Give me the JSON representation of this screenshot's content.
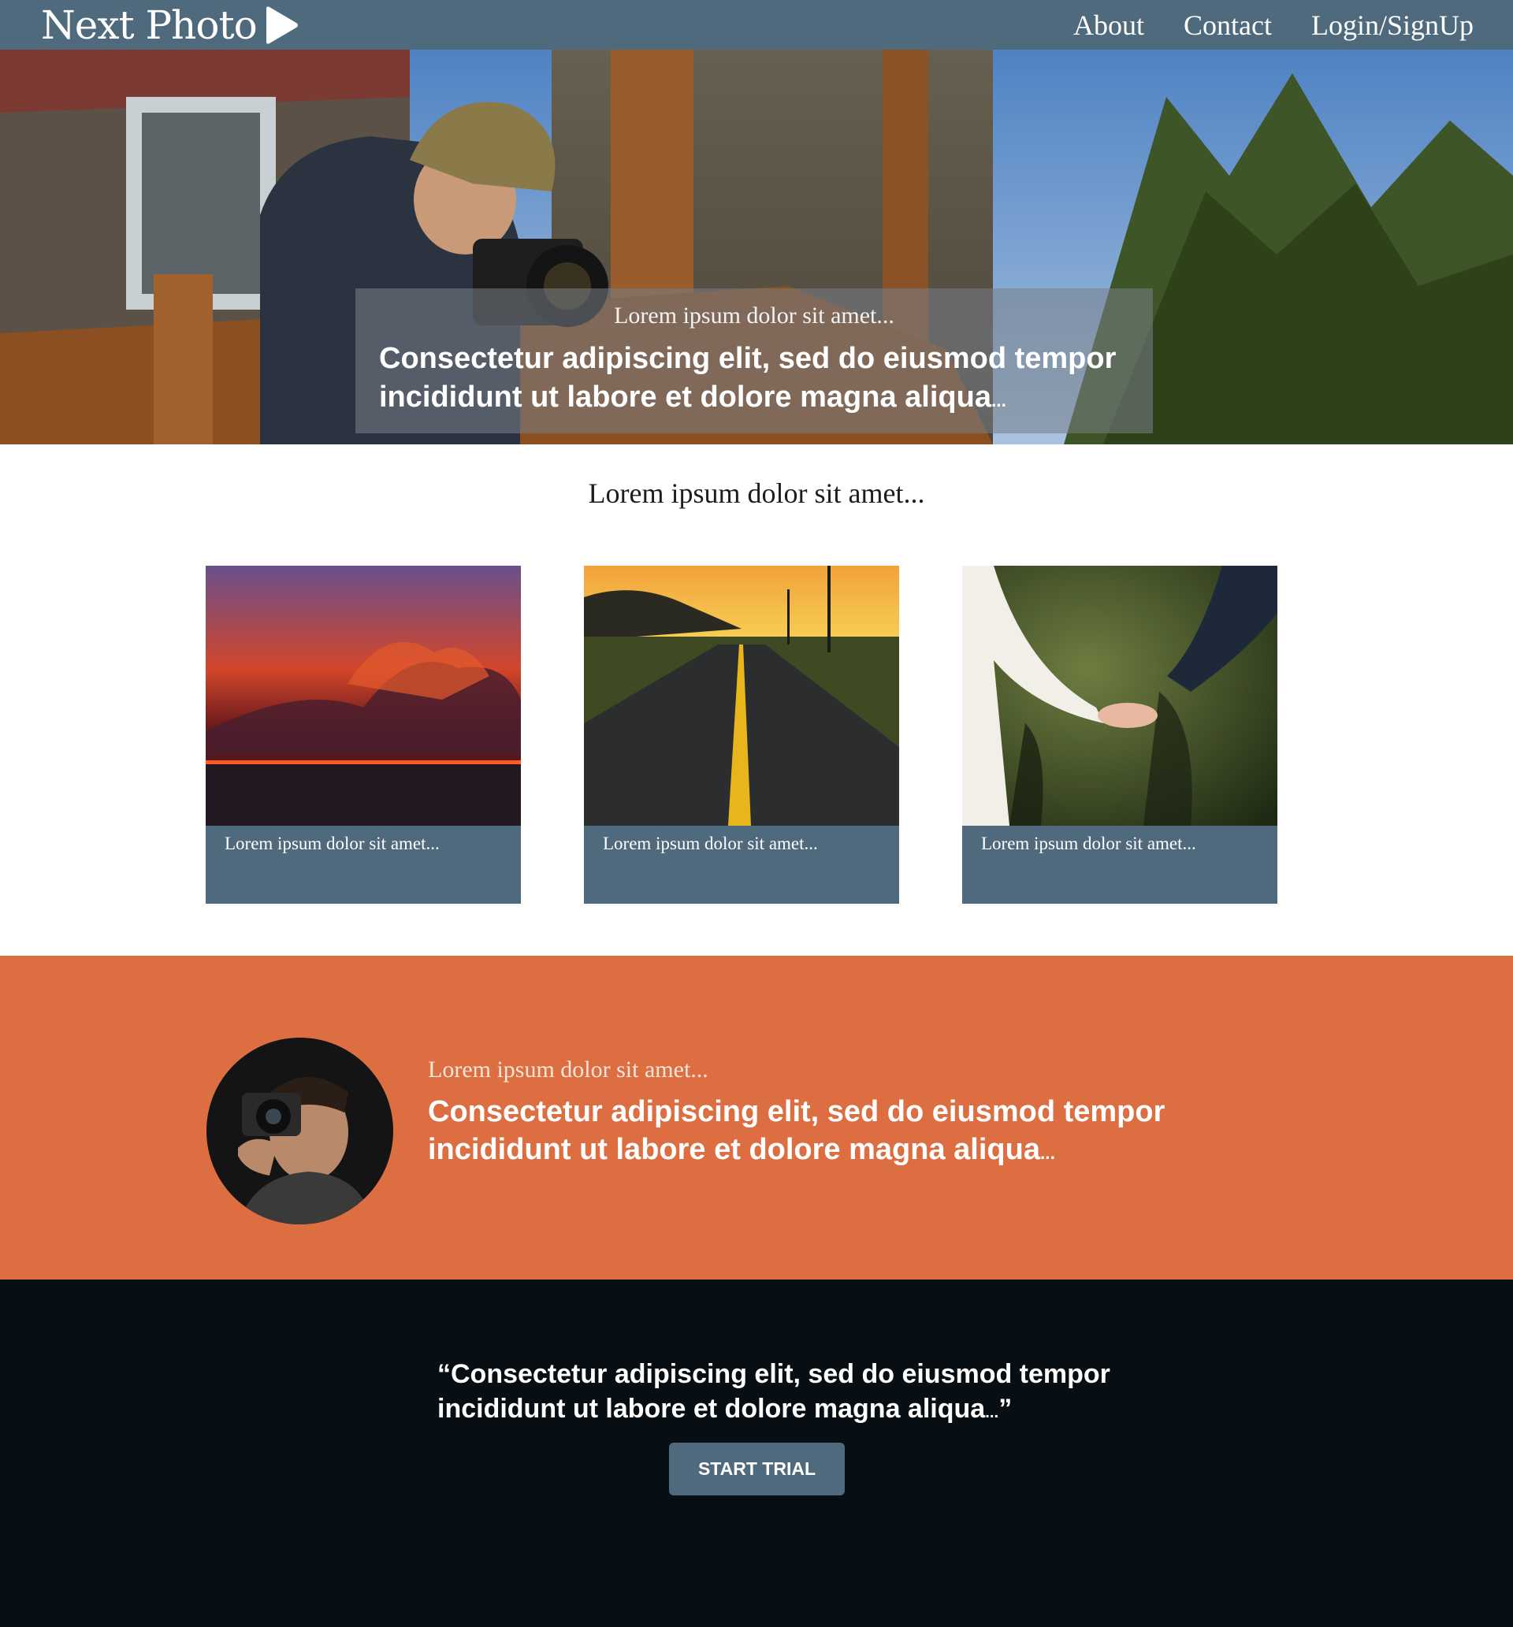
{
  "brand": {
    "name": "Next Photo",
    "play_icon": "play-triangle-icon"
  },
  "nav": {
    "links": [
      "About",
      "Contact",
      "Login/SignUp"
    ]
  },
  "hero": {
    "kicker": "Lorem ipsum dolor sit amet...",
    "headline_line1": "Consectetur adipiscing elit, sed do eiusmod tempor",
    "headline_line2": "incididunt ut labore et dolore magna aliqua",
    "ellipsis": "..."
  },
  "gallery": {
    "intro": "Lorem ipsum dolor sit amet...",
    "cards": [
      {
        "caption": "Lorem ipsum dolor sit amet..."
      },
      {
        "caption": "Lorem ipsum dolor sit amet..."
      },
      {
        "caption": "Lorem ipsum dolor sit amet..."
      }
    ]
  },
  "feature": {
    "kicker": "Lorem ipsum dolor sit amet...",
    "headline_line1": "Consectetur adipiscing elit, sed do eiusmod tempor",
    "headline_line2": "incididunt ut labore et dolore magna aliqua",
    "ellipsis": "..."
  },
  "testimonial": {
    "quote_line1": "“Consectetur adipiscing elit, sed do eiusmod tempor",
    "quote_line2": "incididunt ut labore et dolore magna aliqua",
    "ellipsis": "...",
    "close_quote": "”",
    "cta_label": "START TRIAL"
  },
  "colors": {
    "nav": "#4f6a7c",
    "accent_orange": "#dc6e42",
    "dark": "#070f15",
    "card": "#4f6a7c"
  }
}
